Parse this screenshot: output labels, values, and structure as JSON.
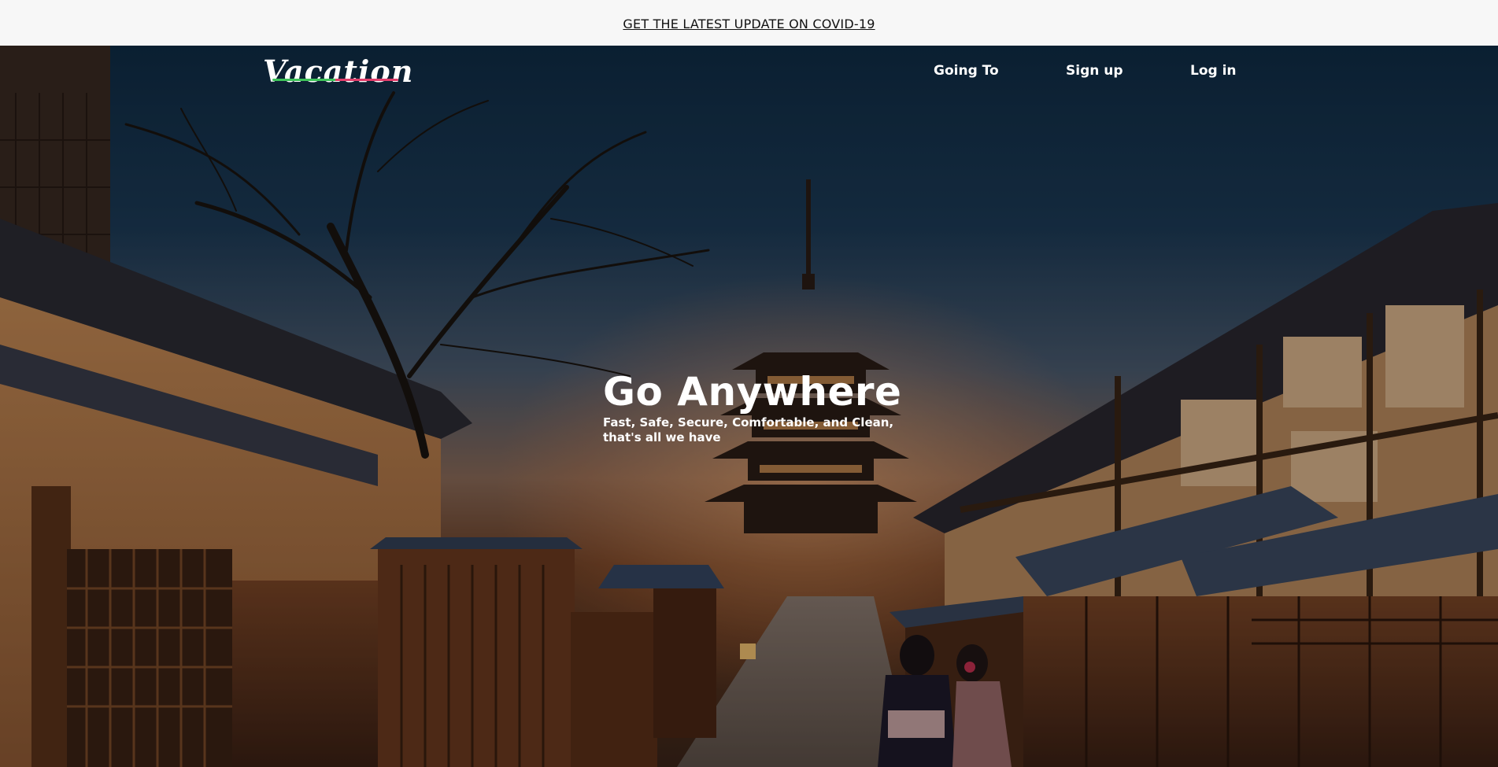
{
  "banner": {
    "link_text": "GET THE LATEST UPDATE ON COVID-19"
  },
  "navbar": {
    "logo": "Vacation",
    "logo_underline_colors": [
      "#3ec35a",
      "#e23d6b"
    ],
    "links": [
      {
        "label": "Going To"
      },
      {
        "label": "Sign up"
      },
      {
        "label": "Log in"
      }
    ]
  },
  "hero": {
    "title": "Go Anywhere",
    "subtitle_line1": "Fast, Safe, Secure, Comfortable, and Clean,",
    "subtitle_line2": "that's all we have",
    "background_subject": "kyoto-street-with-pagoda-at-dusk"
  }
}
